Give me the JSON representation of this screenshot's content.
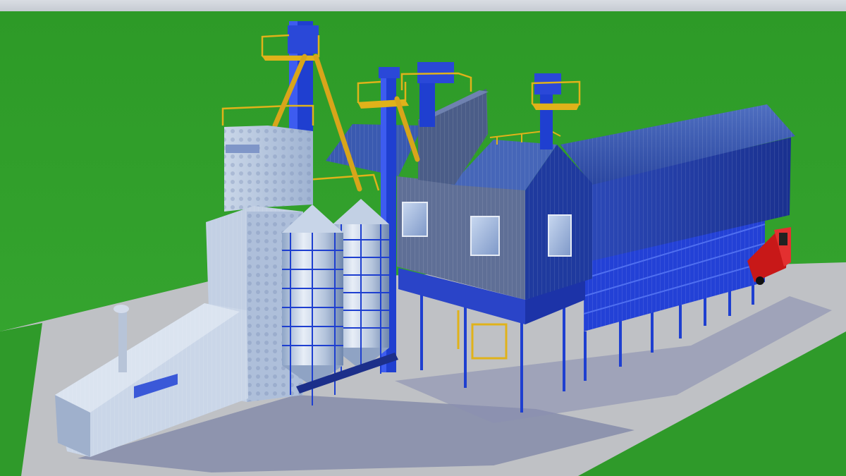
{
  "scene": {
    "subject": "grain-drying-and-storage-plant-3d-render",
    "colors": {
      "grass": "#2f9a2a",
      "concrete": "#bcbec2",
      "steel_blue": "#1f3fc4",
      "galvanized": "#b9c8dc",
      "railing_yellow": "#e0b21a",
      "truck_red": "#d21f1f"
    },
    "icons": [
      "silo-left",
      "silo-right",
      "bucket-elevator",
      "dryer-tower",
      "warehouse",
      "truck"
    ]
  }
}
